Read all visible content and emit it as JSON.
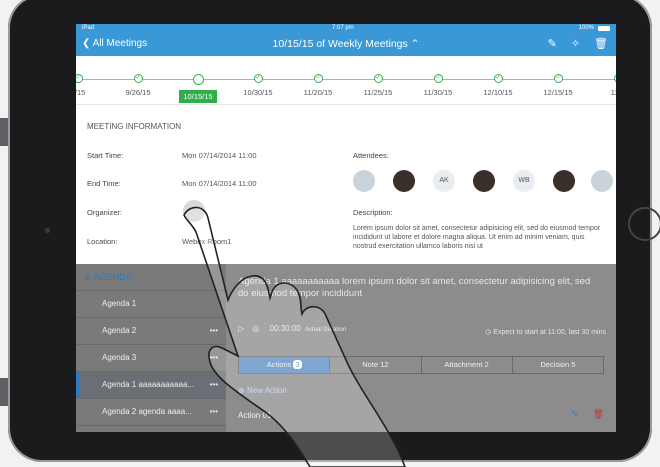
{
  "statusbar": {
    "device": "iPad",
    "time": "7:07 pm",
    "battery": "100%"
  },
  "navbar": {
    "back_label": "All Meetings",
    "title": "10/15/15 of Weekly Meetings ⌃"
  },
  "timeline": [
    "0/15",
    "9/26/15",
    "10/15/15",
    "10/30/15",
    "11/20/15",
    "11/25/15",
    "11/30/15",
    "12/10/15",
    "12/15/15",
    "12/2"
  ],
  "timeline_active": "10/15/15",
  "meeting": {
    "section_title": "MEETING INFORMATION",
    "start_label": "Start Time:",
    "start_value": "Mon 07/14/2014 11:00",
    "end_label": "End Time:",
    "end_value": "Mon 07/14/2014 11:00",
    "organizer_label": "Organizer:",
    "location_label": "Location:",
    "location_value": "Webex Room1",
    "attendees_label": "Attendees:",
    "attendee_initials": [
      "AK",
      "WB"
    ],
    "description_label": "Description:",
    "description": "Lorem ipsum dolor sit amet, consectetur adipisicing elit, sed do eiusmod tempor incididunt ut labore et dolore magna aliqua. Ut enim ad minim veniam, quis nostrud exercitation ullamco laboris nisi ut"
  },
  "agenda": {
    "header": "AGENDA",
    "items": [
      "Agenda 1",
      "Agenda 2",
      "Agenda 3",
      "Agenda 1 aaaaaaaaaaa...",
      "Agenda 2 agenda aaaa..."
    ],
    "dots": "•••"
  },
  "detail": {
    "title": "Agenda 1 aaaaaaaaaaa lorem ipsum dolor sit amet, consectetur adipisicing elit, sed do eiusmod tempor incididunt",
    "duration": "00:30:00",
    "duration_label": "Actual Duration",
    "expect": "Expect to start at 11:00, last 30 mins",
    "tabs": [
      {
        "label": "Actions",
        "count": "3"
      },
      {
        "label": "Note",
        "count": "12"
      },
      {
        "label": "Attachment",
        "count": "2"
      },
      {
        "label": "Decision",
        "count": "5"
      }
    ],
    "new_action": "New Action",
    "action_row": "Action 01"
  }
}
